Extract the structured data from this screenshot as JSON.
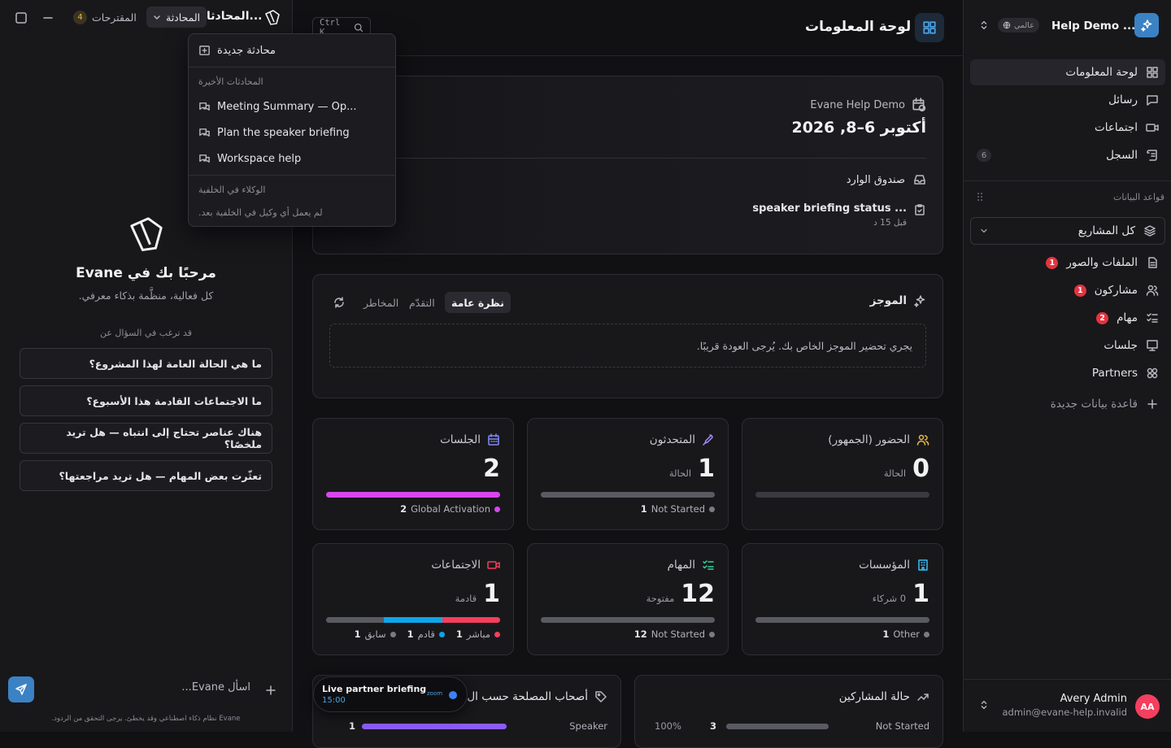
{
  "chat": {
    "topbar": {
      "title": "المحادثا...",
      "conversation_label": "المحادثة",
      "suggestions_label": "المقترحات",
      "suggestions_count": "4"
    },
    "dropdown": {
      "new_chat": "محادثة جديدة",
      "recent_header": "المحادثات الأخيرة",
      "recent": [
        "Meeting Summary — Op...",
        "Plan the speaker briefing",
        "Workspace help"
      ],
      "agents_header": "الوكلاء في الخلفية",
      "agents_empty": "لم يعمل أي وكيل في الخلفية بعد."
    },
    "welcome_title": "مرحبًا بك في Evane",
    "welcome_sub": "كل فعالية، منظَّمة بذكاء معرفي.",
    "ask_header": "قد ترغب في السؤال عن",
    "suggestions": [
      "ما هي الحالة العامة لهذا المشروع؟",
      "ما الاجتماعات القادمة هذا الأسبوع؟",
      "هناك عناصر تحتاج إلى انتباه — هل تريد ملخصًا؟",
      "تعثّرت بعض المهام — هل تريد مراجعتها؟"
    ],
    "input_placeholder": "اسأل Evane...",
    "disclaimer": "Evane نظام ذكاء اصطناعي وقد يخطئ. يرجى التحقق من الردود."
  },
  "main": {
    "title": "لوحة المعلومات",
    "search_shortcut": "Ctrl K",
    "event": {
      "org": "Evane Help Demo",
      "dates": "أكتوبر 6–8, 2026",
      "inbox_label": "صندوق الوارد",
      "inbox_item": "speaker briefing status ...",
      "inbox_time": "قبل 15 د"
    },
    "brief": {
      "title": "الموجز",
      "tabs": [
        "نظرة عامة",
        "التقدّم",
        "المخاطر"
      ],
      "active_tab": "نظرة عامة",
      "message": "يجري تحضير الموجز الخاص بك. يُرجى العودة قريبًا."
    },
    "stats": [
      {
        "title": "الحضور (الجمهور)",
        "value": "0",
        "sub": "الحالة",
        "fill": 0,
        "legend": []
      },
      {
        "title": "المتحدثون",
        "value": "1",
        "sub": "الحالة",
        "legend": [
          {
            "count": "1",
            "label": "Not Started",
            "color": "#7a7a82"
          }
        ]
      },
      {
        "title": "الجلسات",
        "value": "2",
        "sub": "",
        "legend": [
          {
            "count": "2",
            "label": "Global Activation",
            "color": "#d946ef"
          }
        ]
      },
      {
        "title": "المؤسسات",
        "value": "1",
        "sub": "0 شركاء",
        "legend": [
          {
            "count": "1",
            "label": "Other",
            "color": "#7a7a82"
          }
        ]
      },
      {
        "title": "المهام",
        "value": "12",
        "sub": "مفتوحة",
        "legend": [
          {
            "count": "12",
            "label": "Not Started",
            "color": "#7a7a82"
          }
        ]
      },
      {
        "title": "الاجتماعات",
        "value": "1",
        "sub": "قادمة",
        "legend": [
          {
            "count": "1",
            "label": "مباشر",
            "color": "#f43f5e"
          },
          {
            "count": "1",
            "label": "قادم",
            "color": "#0ea5e9"
          },
          {
            "count": "1",
            "label": "سابق",
            "color": "#7a7a82"
          }
        ]
      }
    ],
    "bottom": {
      "stakeholders_title": "أصحاب المصلحة حسب ال",
      "stakeholders_row_label": "Speaker",
      "stakeholders_row_value": "1",
      "participants_title": "حالة المشاركين",
      "participants_row_label": "Not Started",
      "participants_row_value": "3",
      "participants_row_pct": "100%"
    },
    "live": {
      "title": "Live partner briefing",
      "time": "15:00",
      "badge": "zoom"
    }
  },
  "sidebar": {
    "workspace": "Help Demo ...",
    "scope": "عالمي",
    "nav": [
      {
        "label": "لوحة المعلومات",
        "badge": ""
      },
      {
        "label": "رسائل",
        "badge": ""
      },
      {
        "label": "اجتماعات",
        "badge": ""
      },
      {
        "label": "السجل",
        "badge": "6"
      }
    ],
    "db_header": "قواعد البيانات",
    "project_select": "كل المشاريع",
    "dbs": [
      {
        "label": "الملفات والصور",
        "badge": "1"
      },
      {
        "label": "مشاركون",
        "badge": "1"
      },
      {
        "label": "مهام",
        "badge": "2"
      },
      {
        "label": "جلسات",
        "badge": ""
      },
      {
        "label": "Partners",
        "badge": ""
      }
    ],
    "new_db": "قاعدة بيانات جديدة",
    "user": {
      "name": "Avery Admin",
      "email": "admin@evane-help.invalid",
      "initials": "AA"
    }
  }
}
